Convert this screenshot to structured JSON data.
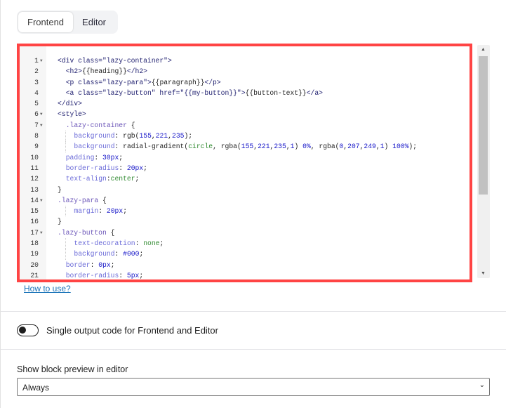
{
  "tabs": [
    {
      "label": "Frontend",
      "active": true
    },
    {
      "label": "Editor",
      "active": false
    }
  ],
  "code_lines": [
    {
      "n": "1",
      "fold": true,
      "indent": 0,
      "tokens": [
        [
          "tag",
          "<div "
        ],
        [
          "attr",
          "class="
        ],
        [
          "str",
          "\"lazy-container\""
        ],
        [
          "tag",
          ">"
        ]
      ]
    },
    {
      "n": "2",
      "indent": 2,
      "tokens": [
        [
          "tag",
          "<h2>"
        ],
        [
          "plain",
          "{{heading}}"
        ],
        [
          "tag",
          "</h2>"
        ]
      ]
    },
    {
      "n": "3",
      "indent": 2,
      "tokens": [
        [
          "tag",
          "<p "
        ],
        [
          "attr",
          "class="
        ],
        [
          "str",
          "\"lazy-para\""
        ],
        [
          "tag",
          ">"
        ],
        [
          "plain",
          "{{paragraph}}"
        ],
        [
          "tag",
          "</p>"
        ]
      ]
    },
    {
      "n": "4",
      "indent": 2,
      "tokens": [
        [
          "tag",
          "<a "
        ],
        [
          "attr",
          "class="
        ],
        [
          "str",
          "\"lazy-button\" "
        ],
        [
          "attr",
          "href="
        ],
        [
          "str",
          "\"{{my-button}}\""
        ],
        [
          "tag",
          ">"
        ],
        [
          "plain",
          "{{button-text}}"
        ],
        [
          "tag",
          "</a>"
        ]
      ]
    },
    {
      "n": "5",
      "indent": 0,
      "tokens": [
        [
          "tag",
          "</div>"
        ]
      ]
    },
    {
      "n": "6",
      "fold": true,
      "indent": 0,
      "tokens": [
        [
          "tag",
          "<style>"
        ]
      ]
    },
    {
      "n": "7",
      "fold": true,
      "indent": 2,
      "tokens": [
        [
          "sel",
          ".lazy-container "
        ],
        [
          "punc",
          "{"
        ]
      ]
    },
    {
      "n": "8",
      "indent": 4,
      "guide": true,
      "tokens": [
        [
          "prop",
          "background"
        ],
        [
          "punc",
          ": "
        ],
        [
          "plain",
          "rgb("
        ],
        [
          "num",
          "155"
        ],
        [
          "punc",
          ","
        ],
        [
          "num",
          "221"
        ],
        [
          "punc",
          ","
        ],
        [
          "num",
          "235"
        ],
        [
          "plain",
          ");"
        ]
      ]
    },
    {
      "n": "9",
      "indent": 4,
      "guide": true,
      "tokens": [
        [
          "prop",
          "background"
        ],
        [
          "punc",
          ": "
        ],
        [
          "plain",
          "radial-gradient("
        ],
        [
          "kw",
          "circle"
        ],
        [
          "punc",
          ", "
        ],
        [
          "plain",
          "rgba("
        ],
        [
          "num",
          "155"
        ],
        [
          "punc",
          ","
        ],
        [
          "num",
          "221"
        ],
        [
          "punc",
          ","
        ],
        [
          "num",
          "235"
        ],
        [
          "punc",
          ","
        ],
        [
          "num",
          "1"
        ],
        [
          "plain",
          ") "
        ],
        [
          "num",
          "0%"
        ],
        [
          "punc",
          ", "
        ],
        [
          "plain",
          "rgba("
        ],
        [
          "num",
          "0"
        ],
        [
          "punc",
          ","
        ],
        [
          "num",
          "207"
        ],
        [
          "punc",
          ","
        ],
        [
          "num",
          "249"
        ],
        [
          "punc",
          ","
        ],
        [
          "num",
          "1"
        ],
        [
          "plain",
          ") "
        ],
        [
          "num",
          "100%"
        ],
        [
          "plain",
          ");"
        ]
      ]
    },
    {
      "n": "10",
      "indent": 2,
      "tokens": [
        [
          "prop",
          "padding"
        ],
        [
          "punc",
          ": "
        ],
        [
          "num",
          "30px"
        ],
        [
          "punc",
          ";"
        ]
      ]
    },
    {
      "n": "11",
      "indent": 2,
      "tokens": [
        [
          "prop",
          "border-radius"
        ],
        [
          "punc",
          ": "
        ],
        [
          "num",
          "20px"
        ],
        [
          "punc",
          ";"
        ]
      ]
    },
    {
      "n": "12",
      "indent": 2,
      "tokens": [
        [
          "prop",
          "text-align"
        ],
        [
          "punc",
          ":"
        ],
        [
          "kw",
          "center"
        ],
        [
          "punc",
          ";"
        ]
      ]
    },
    {
      "n": "13",
      "indent": 0,
      "tokens": [
        [
          "punc",
          "}"
        ]
      ]
    },
    {
      "n": "14",
      "fold": true,
      "indent": 0,
      "tokens": [
        [
          "sel",
          ".lazy-para "
        ],
        [
          "punc",
          "{"
        ]
      ]
    },
    {
      "n": "15",
      "indent": 4,
      "guide": true,
      "tokens": [
        [
          "prop",
          "margin"
        ],
        [
          "punc",
          ": "
        ],
        [
          "num",
          "20px"
        ],
        [
          "punc",
          ";"
        ]
      ]
    },
    {
      "n": "16",
      "indent": 0,
      "tokens": [
        [
          "punc",
          "}"
        ]
      ]
    },
    {
      "n": "17",
      "fold": true,
      "indent": 0,
      "tokens": [
        [
          "sel",
          ".lazy-button "
        ],
        [
          "punc",
          "{"
        ]
      ]
    },
    {
      "n": "18",
      "indent": 4,
      "guide": true,
      "tokens": [
        [
          "prop",
          "text-decoration"
        ],
        [
          "punc",
          ": "
        ],
        [
          "kw",
          "none"
        ],
        [
          "punc",
          ";"
        ]
      ]
    },
    {
      "n": "19",
      "indent": 4,
      "guide": true,
      "tokens": [
        [
          "prop",
          "background"
        ],
        [
          "punc",
          ": "
        ],
        [
          "num",
          "#000"
        ],
        [
          "punc",
          ";"
        ]
      ]
    },
    {
      "n": "20",
      "indent": 2,
      "tokens": [
        [
          "prop",
          "border"
        ],
        [
          "punc",
          ": "
        ],
        [
          "num",
          "0px"
        ],
        [
          "punc",
          ";"
        ]
      ]
    },
    {
      "n": "21",
      "indent": 2,
      "tokens": [
        [
          "prop",
          "border-radius"
        ],
        [
          "punc",
          ": "
        ],
        [
          "num",
          "5px"
        ],
        [
          "punc",
          ";"
        ]
      ]
    }
  ],
  "help_link": "How to use?",
  "toggle": {
    "label": "Single output code for Frontend and Editor",
    "on": false
  },
  "preview": {
    "label": "Show block preview in editor",
    "value": "Always"
  },
  "colors": {
    "highlight_border": "#ff4444",
    "link": "#1a73b8"
  }
}
